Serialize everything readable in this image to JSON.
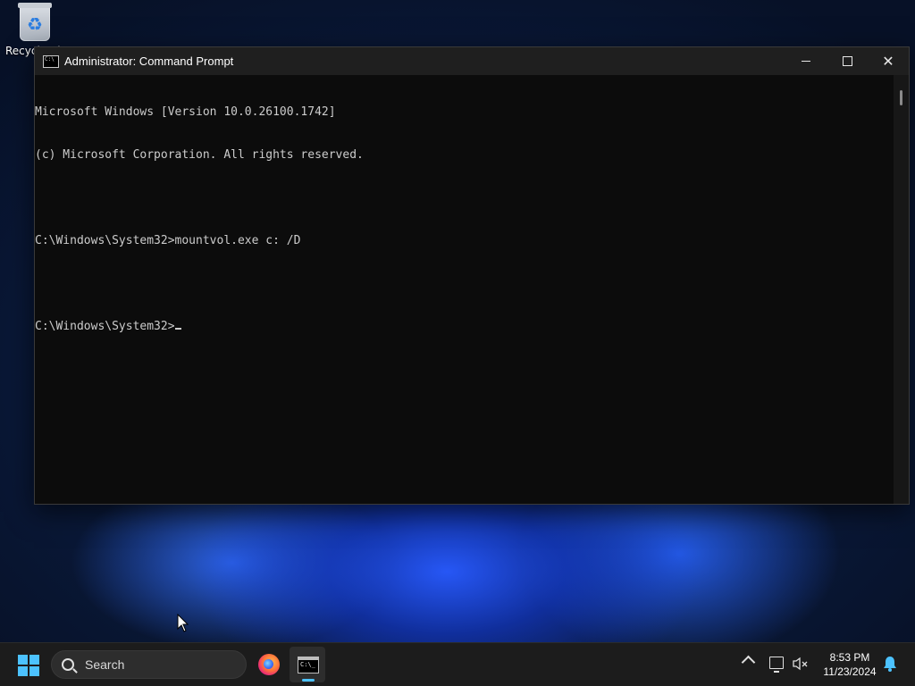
{
  "desktop": {
    "icons": [
      {
        "label": "Recycle Bin",
        "icon": "recycle-bin-icon"
      }
    ]
  },
  "window": {
    "title": "Administrator: Command Prompt",
    "icon": "cmd-icon",
    "controls": {
      "minimize": "minimize-icon",
      "maximize": "maximize-icon",
      "close": "close-icon"
    },
    "console_lines": [
      "Microsoft Windows [Version 10.0.26100.1742]",
      "(c) Microsoft Corporation. All rights reserved.",
      "",
      "C:\\Windows\\System32>mountvol.exe c: /D",
      "",
      "C:\\Windows\\System32>"
    ],
    "colors": {
      "console_bg": "#0c0c0c",
      "console_text": "#cccccc",
      "titlebar_bg": "#1f1f1f"
    }
  },
  "taskbar": {
    "search_placeholder": "Search",
    "apps": [
      {
        "name": "Firefox",
        "icon": "firefox-icon",
        "active": false
      },
      {
        "name": "Command Prompt",
        "icon": "cmd-icon",
        "active": true
      }
    ],
    "tray": {
      "time": "8:53 PM",
      "date": "11/23/2024",
      "icons": [
        "chevron-up-icon",
        "network-icon",
        "speaker-muted-icon",
        "notification-bell-icon"
      ]
    },
    "accent": "#4cc2ff"
  }
}
